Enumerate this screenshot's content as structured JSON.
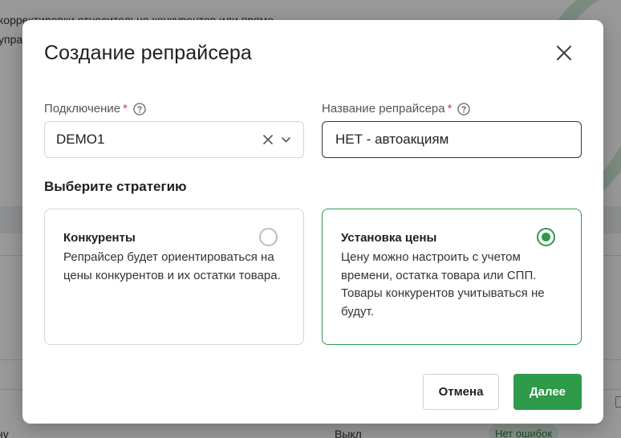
{
  "background": {
    "line1": "корректировки относительно конкурентов или прямо",
    "line2": "управ",
    "row_cell_left": "ну",
    "row_cell_status": "Выкл",
    "row_badge": "Нет ошибок"
  },
  "modal": {
    "title": "Создание репрайсера",
    "close_icon": "close-icon",
    "connection": {
      "label": "Подключение",
      "required_mark": "*",
      "value": "DEMO1"
    },
    "name": {
      "label": "Название репрайсера",
      "required_mark": "*",
      "value": "НЕТ - автоакциям"
    },
    "strategy_title": "Выберите стратегию",
    "strategies": [
      {
        "title": "Конкуренты",
        "description": "Репрайсер будет ориентироваться на цены конкурентов и их остатки товара.",
        "selected": false
      },
      {
        "title": "Установка цены",
        "description": "Цену можно настроить с учетом времени, остатка товара или СПП. Товары конкурентов учитываться не будут.",
        "selected": true
      }
    ],
    "buttons": {
      "cancel": "Отмена",
      "next": "Далее"
    }
  },
  "colors": {
    "accent": "#2e9a4a",
    "required": "#d63b3b",
    "overlay": "rgba(0,0,0,0.40)"
  }
}
